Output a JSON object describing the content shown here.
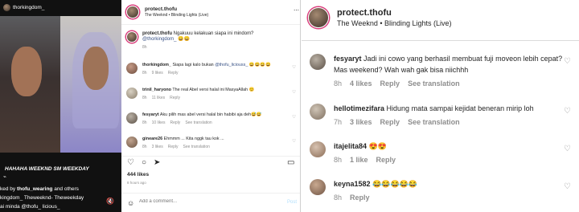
{
  "media": {
    "top_username": "thorkingdom_",
    "caption_overlay": "HAHAHA WEEKND SM WEEKDAY",
    "liked_by_prefix": "ked by",
    "liked_by_user": "thofu_wearing",
    "liked_by_suffix": "and others",
    "caption_line": "kingdom_ Theweeknd- Theweekday",
    "caption_line2": "ai minda @thofu_ licious_",
    "emoji": "👌"
  },
  "left": {
    "header": {
      "username": "protect.thofu",
      "subtitle": "The Weeknd • Blinding Lights (Live)"
    },
    "caption": {
      "username": "protect.thofu",
      "text": "Ngakuuu kelakuan siapa ini mindom?",
      "mention": "@thorkingdom_",
      "emoji": "😄😄",
      "time": "8h"
    },
    "comments": [
      {
        "username": "thorkingdom_",
        "text": "Siapa lagi kalo bukan",
        "mention": "@thofu_liciouss_",
        "emoji": "😄😄😄😄",
        "time": "8h",
        "likes": "9 likes",
        "reply": "Reply"
      },
      {
        "username": "trinil_haryono",
        "text": "The real Abel versi halal ini MasyaAllah 😊",
        "mention": "",
        "emoji": "",
        "time": "8h",
        "likes": "11 likes",
        "reply": "Reply"
      },
      {
        "username": "fesyaryt",
        "text": "Aku pilih mas abel versi halal bin habibi aja deh😅😅",
        "mention": "",
        "emoji": "",
        "time": "8h",
        "likes": "10 likes",
        "reply": "Reply",
        "translation": "See translation"
      },
      {
        "username": "gineare26",
        "text": "Ehmmm ... Kita nggk tau kok ...",
        "mention": "",
        "emoji": "",
        "time": "8h",
        "likes": "3 likes",
        "reply": "Reply",
        "translation": "See translation"
      }
    ],
    "likes_count": "444 likes",
    "posted_ago": "8 hours ago",
    "add_comment_placeholder": "Add a comment...",
    "post_label": "Post"
  },
  "right": {
    "header": {
      "username": "protect.thofu",
      "subtitle": "The Weeknd • Blinding Lights (Live)"
    },
    "comments": [
      {
        "username": "fesyaryt",
        "text": "Jadi ini cowo yang berhasil membuat fuji moveon lebih cepat? Mas weekend? Wah wah gak bisa niichhh",
        "time": "8h",
        "likes": "4 likes",
        "reply": "Reply",
        "translation": "See translation"
      },
      {
        "username": "hellotimezifara",
        "text": "Hidung mata sampai kejidat beneran mirip loh",
        "time": "7h",
        "likes": "3 likes",
        "reply": "Reply",
        "translation": "See translation"
      },
      {
        "username": "itajelita84",
        "text": "😍😍",
        "time": "8h",
        "likes": "1 like",
        "reply": "Reply",
        "translation": ""
      },
      {
        "username": "keyna1582",
        "text": "😂😂😂😂😂",
        "time": "8h",
        "likes": "",
        "reply": "Reply",
        "translation": ""
      }
    ]
  },
  "colors": {
    "accent": "#385185",
    "muted": "#8e8e8e",
    "ring": "#d93b7a"
  }
}
